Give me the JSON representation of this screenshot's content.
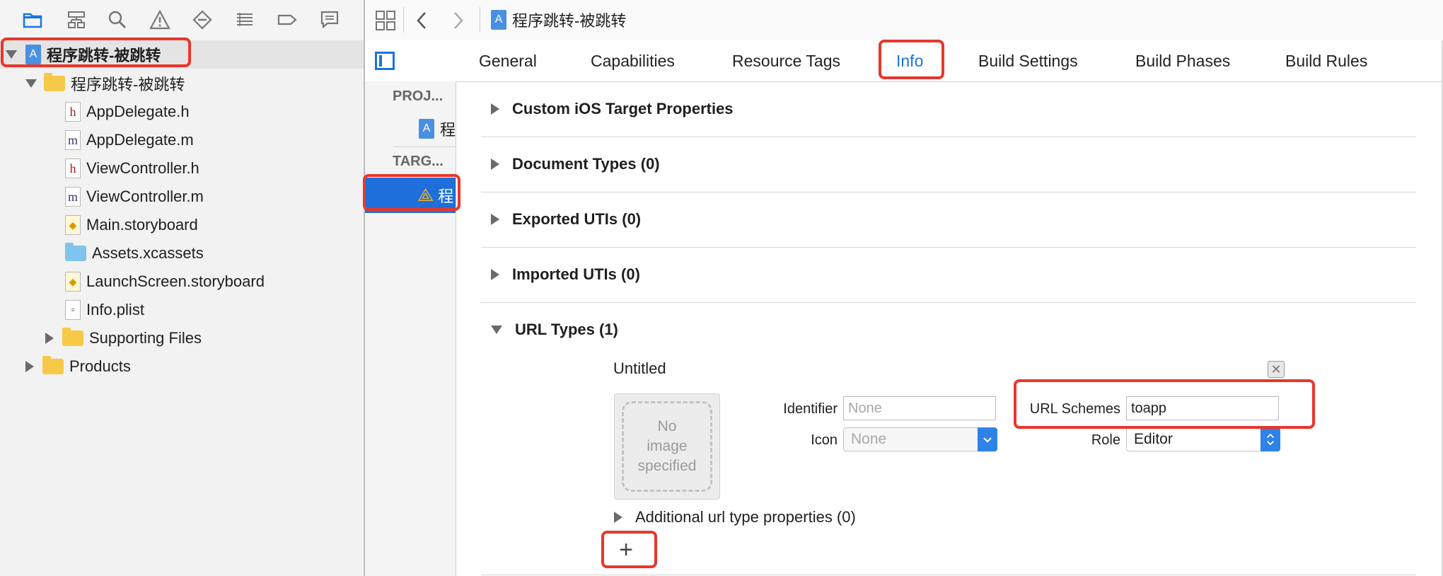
{
  "navigator": {
    "toolbar_icons": [
      "folder-icon",
      "hierarchy-icon",
      "search-icon",
      "warning-icon",
      "breakpoint-icon",
      "list-icon",
      "tag-icon",
      "comment-icon"
    ],
    "project_name": "程序跳转-被跳转",
    "group_name": "程序跳转-被跳转",
    "files": [
      {
        "name": "AppDelegate.h",
        "kind": "h"
      },
      {
        "name": "AppDelegate.m",
        "kind": "m"
      },
      {
        "name": "ViewController.h",
        "kind": "h"
      },
      {
        "name": "ViewController.m",
        "kind": "m"
      },
      {
        "name": "Main.storyboard",
        "kind": "storyboard"
      },
      {
        "name": "Assets.xcassets",
        "kind": "assets"
      },
      {
        "name": "LaunchScreen.storyboard",
        "kind": "storyboard"
      },
      {
        "name": "Info.plist",
        "kind": "plist"
      },
      {
        "name": "Supporting Files",
        "kind": "folder"
      }
    ],
    "products": "Products"
  },
  "toolbar": {
    "breadcrumb": "程序跳转-被跳转"
  },
  "tabs": [
    "General",
    "Capabilities",
    "Resource Tags",
    "Info",
    "Build Settings",
    "Build Phases",
    "Build Rules"
  ],
  "active_tab": "Info",
  "targets": {
    "project_header": "PROJ...",
    "project_item": "程",
    "targets_header": "TARG...",
    "target_item": "程"
  },
  "sections": [
    "Custom iOS Target Properties",
    "Document Types (0)",
    "Exported UTIs (0)",
    "Imported UTIs (0)",
    "URL Types (1)"
  ],
  "url_type": {
    "title": "Untitled",
    "image_placeholder": [
      "No",
      "image",
      "specified"
    ],
    "identifier_label": "Identifier",
    "identifier_placeholder": "None",
    "icon_label": "Icon",
    "icon_placeholder": "None",
    "schemes_label": "URL Schemes",
    "schemes_value": "toapp",
    "role_label": "Role",
    "role_value": "Editor",
    "additional": "Additional url type properties (0)",
    "add_button": "+"
  },
  "colors": {
    "accent": "#1a75d8",
    "highlight_box": "#e8372c",
    "selection": "#1e6fd9"
  }
}
